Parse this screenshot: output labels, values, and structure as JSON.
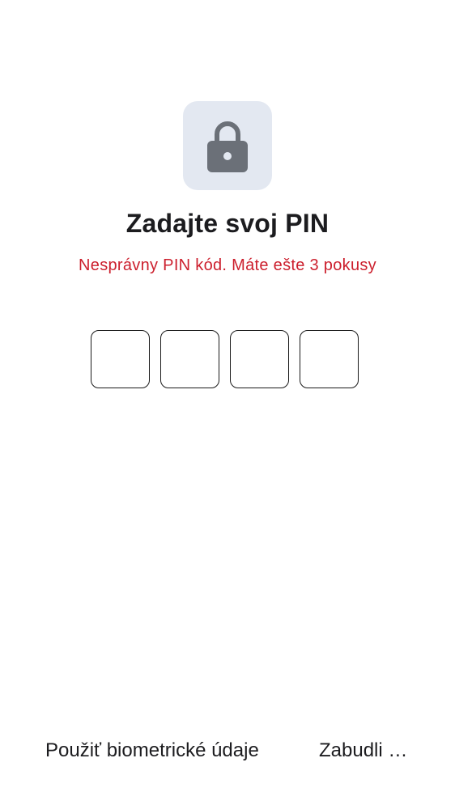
{
  "lock": {
    "icon": "lock-icon"
  },
  "title": "Zadajte svoj PIN",
  "error_message": "Nesprávny PIN kód. Máte ešte 3 pokusy",
  "pin": {
    "digits": 4,
    "entered": [
      "",
      "",
      "",
      ""
    ]
  },
  "actions": {
    "biometric_label": "Použiť biometrické údaje",
    "forgot_label": "Zabudli …"
  },
  "colors": {
    "error": "#cc1f2d",
    "icon_bg": "#e3e8f1",
    "icon": "#6b7078"
  }
}
